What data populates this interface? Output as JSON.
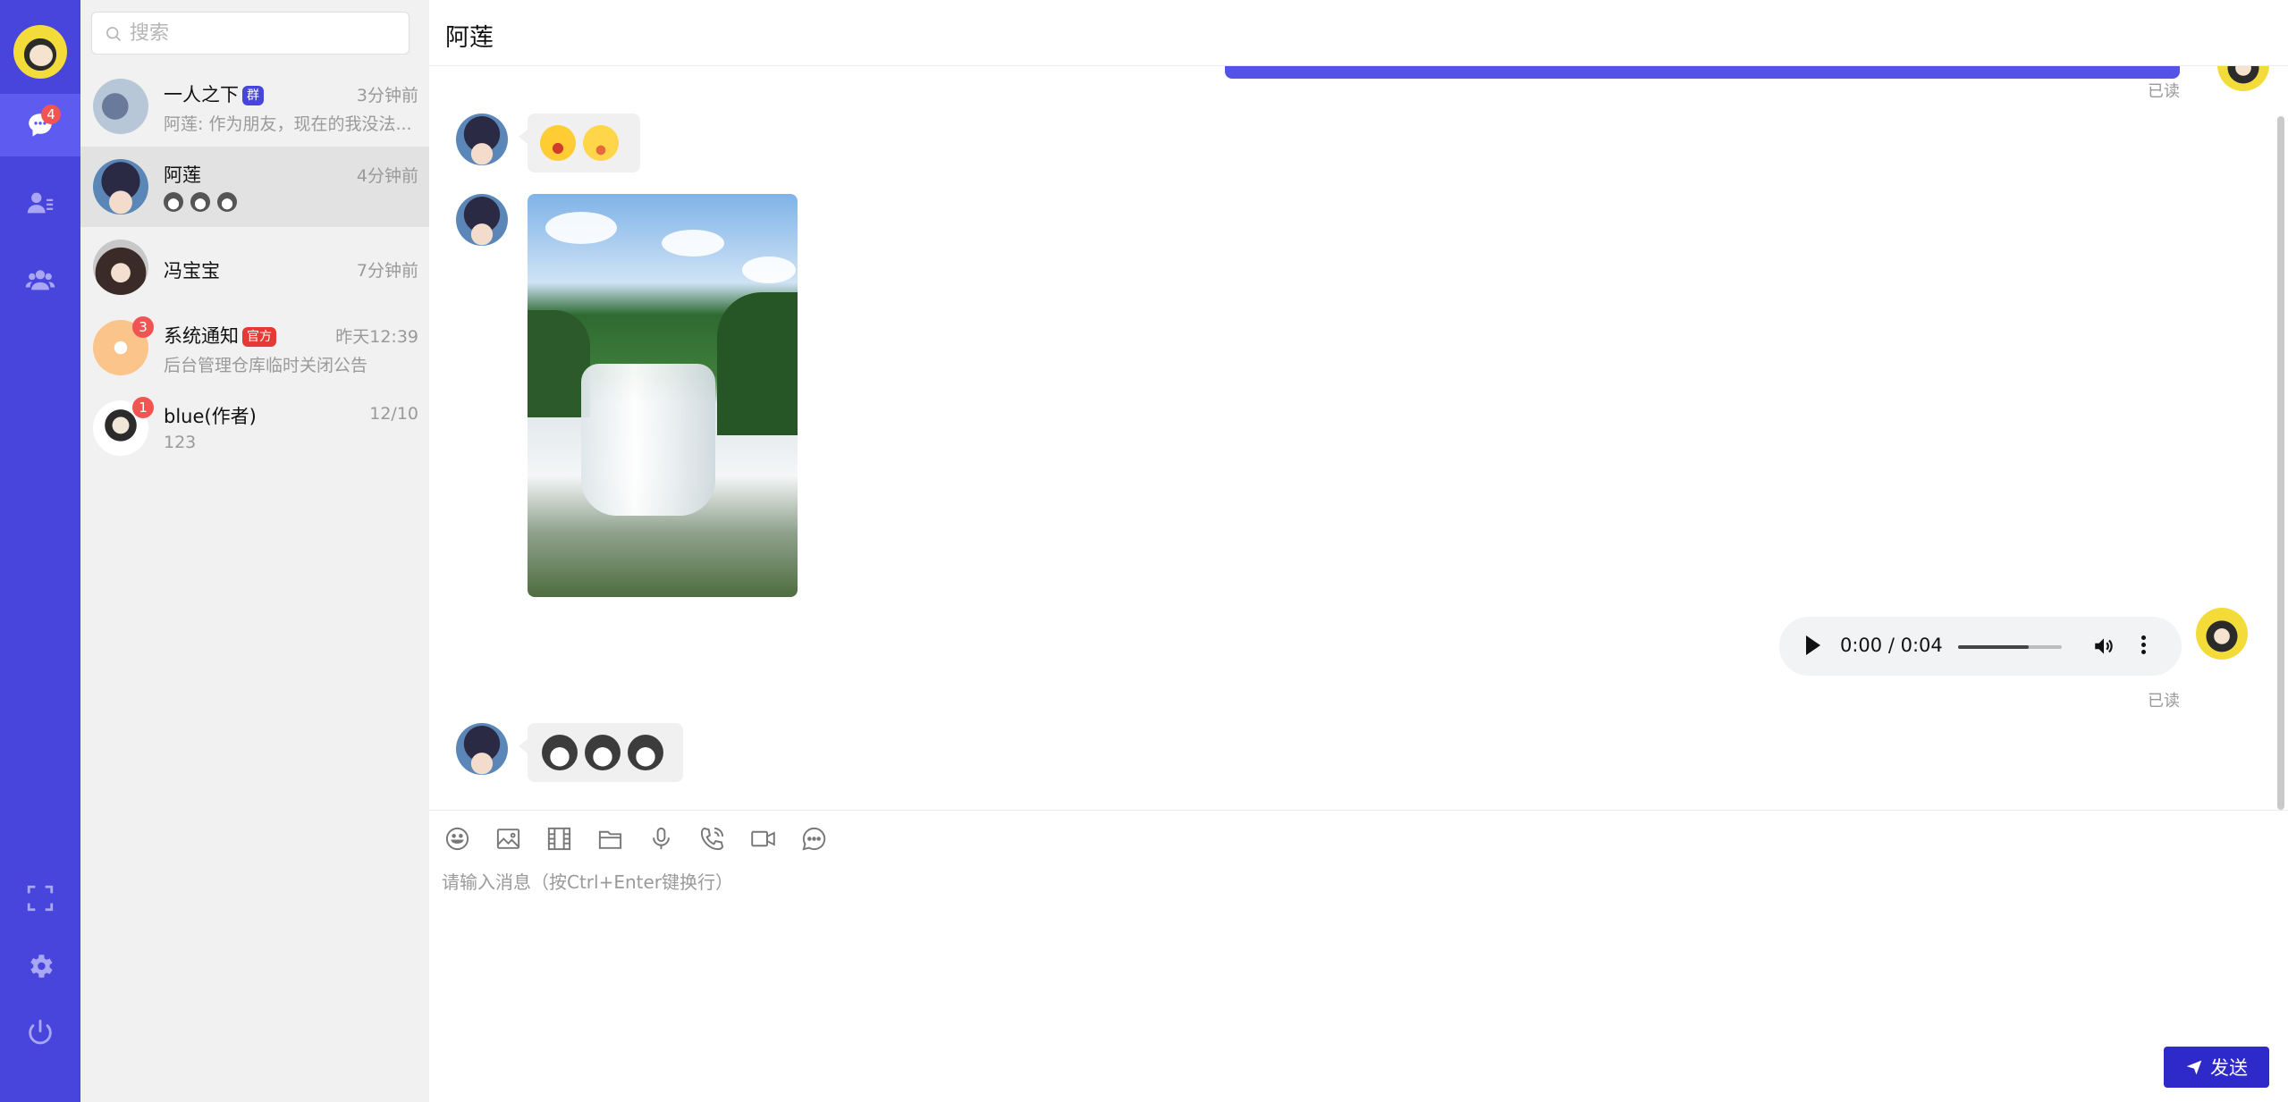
{
  "search": {
    "placeholder": "搜索"
  },
  "rail": {
    "chat_badge": "4"
  },
  "conversations": [
    {
      "name": "一人之下",
      "tag": "群",
      "time": "3分钟前",
      "preview": "阿莲: 作为朋友，现在的我没法..."
    },
    {
      "name": "阿莲",
      "time": "4分钟前",
      "preview": ""
    },
    {
      "name": "冯宝宝",
      "time": "7分钟前",
      "preview": ""
    },
    {
      "name": "系统通知",
      "tag": "官方",
      "badge": "3",
      "time": "昨天12:39",
      "preview": "后台管理仓库临时关闭公告"
    },
    {
      "name": "blue(作者)",
      "badge": "1",
      "time": "12/10",
      "preview": "123"
    }
  ],
  "chat": {
    "title": "阿莲",
    "read_label_1": "已读",
    "read_label_2": "已读",
    "audio": {
      "time": "0:00 / 0:04",
      "progress": 0.68
    }
  },
  "composer": {
    "placeholder": "请输入消息（按Ctrl+Enter键换行）",
    "send_label": "发送"
  },
  "colors": {
    "accent": "#4845dc",
    "badge": "#f25453",
    "send": "#2e2ac9"
  }
}
